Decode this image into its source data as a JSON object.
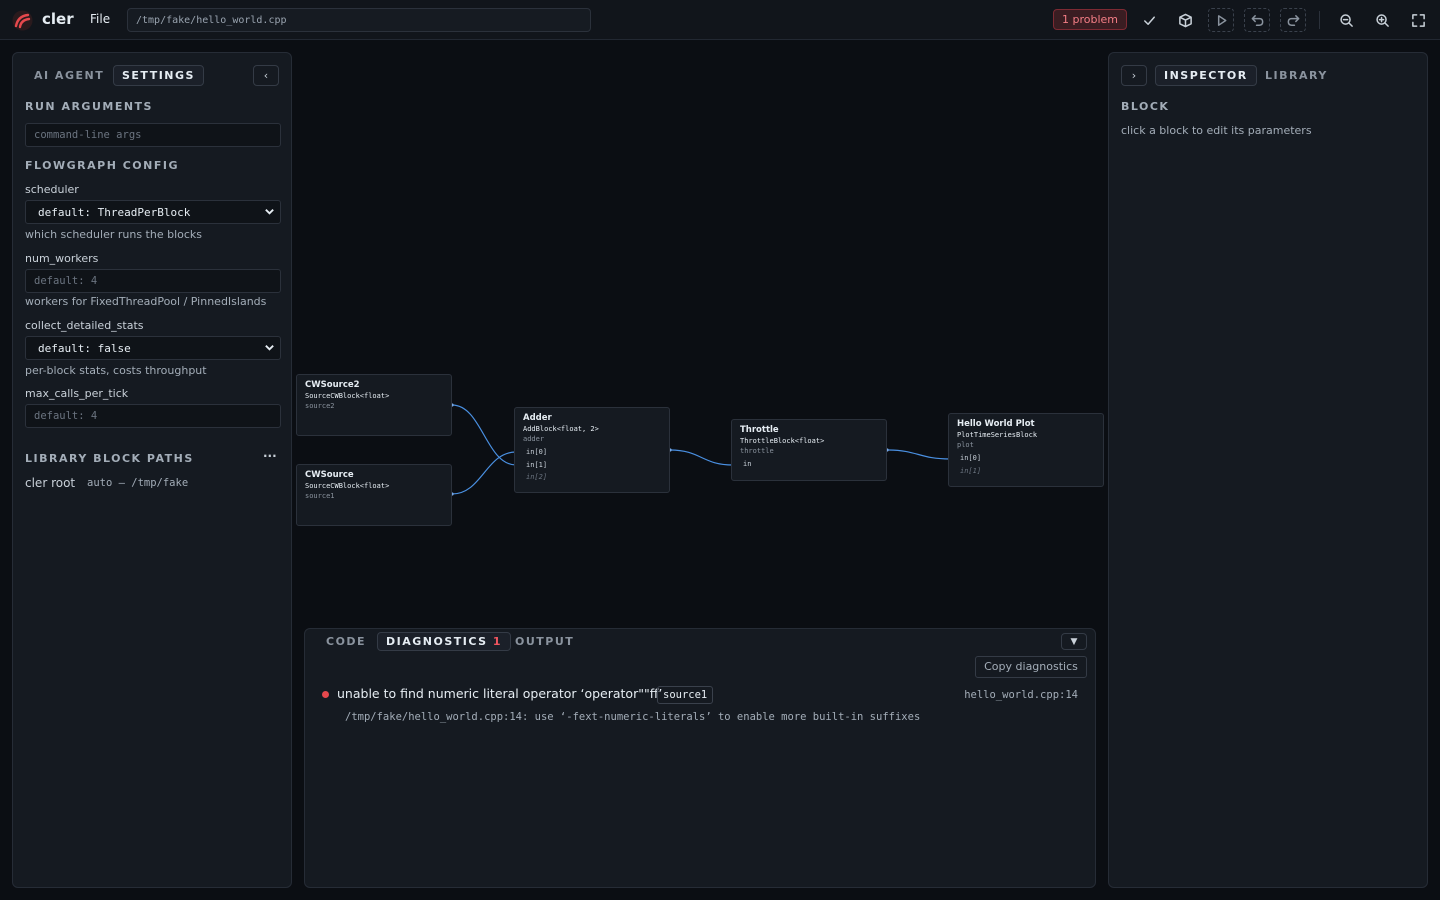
{
  "topbar": {
    "app_name": "cler",
    "file_menu": "File",
    "file_path": "/tmp/fake/hello_world.cpp",
    "problem_badge": "1 problem",
    "icons": [
      "check-icon",
      "build-cube-icon",
      "run-icon",
      "undo-icon",
      "redo-icon",
      "zoom-out-icon",
      "zoom-in-icon",
      "fullscreen-icon"
    ],
    "logo_color": "#e5484d"
  },
  "left_panel": {
    "tabs": [
      "AI AGENT",
      "SETTINGS"
    ],
    "active_tab": "SETTINGS",
    "collapse_label": "‹",
    "run_args_title": "RUN ARGUMENTS",
    "run_args_placeholder": "command-line args",
    "flowgraph_title": "FLOWGRAPH CONFIG",
    "scheduler": {
      "label": "scheduler",
      "value": "default: ThreadPerBlock",
      "help": "which scheduler runs the blocks"
    },
    "num_workers": {
      "label": "num_workers",
      "placeholder": "default: 4",
      "help": "workers for FixedThreadPool / PinnedIslands"
    },
    "collect_detailed_stats": {
      "label": "collect_detailed_stats",
      "value": "default: false",
      "help": "per-block stats, costs throughput"
    },
    "max_calls_per_tick": {
      "label": "max_calls_per_tick",
      "placeholder": "default: 4"
    },
    "library_title": "LIBRARY BLOCK PATHS",
    "library_more": "···",
    "library_path": {
      "name": "cler root",
      "value": "auto — /tmp/fake"
    }
  },
  "graph": {
    "nodes": [
      {
        "title": "CWSource2",
        "type": "SourceCWBlock<float>",
        "id": "source2",
        "ports": []
      },
      {
        "title": "CWSource",
        "type": "SourceCWBlock<float>",
        "id": "source1",
        "ports": []
      },
      {
        "title": "Adder",
        "type": "AddBlock<float, 2>",
        "id": "adder",
        "ports": [
          "in[0]",
          "in[1]",
          "in[2]"
        ]
      },
      {
        "title": "Throttle",
        "type": "ThrottleBlock<float>",
        "id": "throttle",
        "ports": [
          "in"
        ]
      },
      {
        "title": "Hello World Plot",
        "type": "PlotTimeSeriesBlock",
        "id": "plot",
        "ports": [
          "in[0]",
          "in[1]"
        ]
      }
    ],
    "edge_color": "#4a90e2"
  },
  "bottom_panel": {
    "tabs": [
      "CODE",
      "DIAGNOSTICS",
      "OUTPUT"
    ],
    "active_tab": "DIAGNOSTICS",
    "diagnostics_count": "1",
    "collapse_label": "▼",
    "copy_button": "Copy diagnostics",
    "diagnostic": {
      "message": "unable to find numeric literal operator ‘operator\"\"ff’",
      "block": "source1",
      "location": "hello_world.cpp:14",
      "detail": "/tmp/fake/hello_world.cpp:14: use ‘-fext-numeric-literals’ to enable more built-in suffixes"
    }
  },
  "right_panel": {
    "expand_label": "›",
    "tabs": [
      "INSPECTOR",
      "LIBRARY"
    ],
    "active_tab": "INSPECTOR",
    "block_title": "BLOCK",
    "hint": "click a block to edit its parameters"
  }
}
